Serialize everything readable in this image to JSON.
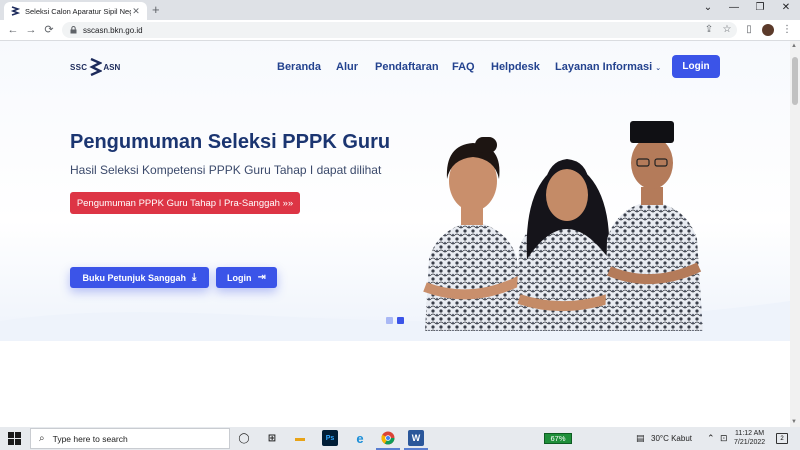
{
  "browser": {
    "tab_title": "Seleksi Calon Aparatur Sipil Negara",
    "tab_close": "✕",
    "new_tab": "+",
    "url": "sscasn.bkn.go.id",
    "icons": {
      "back": "←",
      "forward": "→",
      "reload": "⟳",
      "share": "⇪",
      "bookmark": "☆",
      "side_panel": "▯",
      "menu": "⋮",
      "minimize": "—",
      "maximize": "❐",
      "close": "✕",
      "dropdown": "⌄"
    }
  },
  "site": {
    "logo_left": "SSC",
    "logo_right": "ASN",
    "nav": [
      {
        "label": "Beranda"
      },
      {
        "label": "Alur"
      },
      {
        "label": "Pendaftaran"
      },
      {
        "label": "FAQ"
      },
      {
        "label": "Helpdesk"
      },
      {
        "label": "Layanan Informasi",
        "chevron": "⌄"
      }
    ],
    "login_label": "Login"
  },
  "hero": {
    "title": "Pengumuman Seleksi PPPK Guru",
    "subtitle": "Hasil Seleksi Kompetensi PPPK Guru Tahap I dapat dilihat",
    "announce_button": "Pengumuman PPPK Guru Tahap I Pra-Sanggah »»",
    "guide_button": "Buku Petunjuk Sanggah",
    "guide_icon": "⤓",
    "login_button": "Login",
    "login_icon": "⇥",
    "carousel": {
      "count": 2,
      "active_index": 1
    }
  },
  "taskbar": {
    "search_placeholder": "Type here to search",
    "search_icon": "⌕",
    "task_view_icon": "◯",
    "widgets_icon": "⊞",
    "apps": [
      {
        "name": "file-explorer",
        "glyph": "▬",
        "color": "#e8a317"
      },
      {
        "name": "photoshop",
        "glyph": "Ps",
        "color": "#001e36"
      },
      {
        "name": "edge",
        "glyph": "e",
        "color": "#1b8fd8"
      },
      {
        "name": "chrome",
        "glyph": "●",
        "color": "#db4437",
        "active": true
      },
      {
        "name": "word",
        "glyph": "W",
        "color": "#2b579a",
        "active": true
      }
    ],
    "battery": "67%",
    "weather": "30°C  Kabut",
    "tray_icons": {
      "up_arrow": "⌃",
      "network": "⊡",
      "volume": "◁",
      "keyboard": "⌨"
    },
    "time": "11:12 AM",
    "date": "7/21/2022",
    "notification_count": "2"
  },
  "colors": {
    "primary": "#3b54e8",
    "danger": "#dd3545",
    "nav_text": "#24438f",
    "title_text": "#1b3571"
  }
}
